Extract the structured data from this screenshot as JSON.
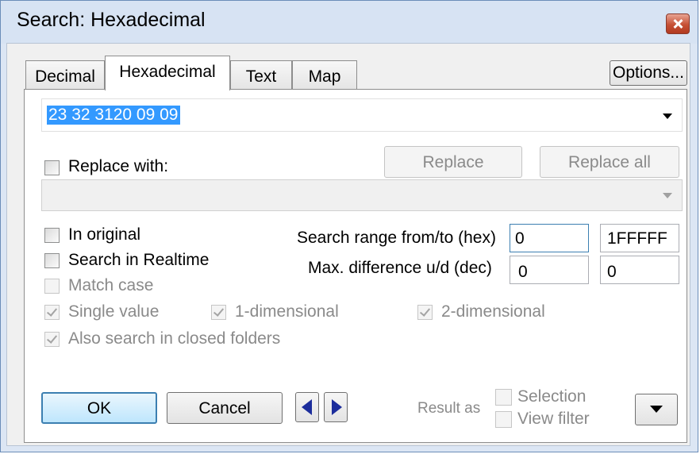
{
  "window": {
    "title": "Search: Hexadecimal"
  },
  "tabs": [
    {
      "label": "Decimal",
      "active": false
    },
    {
      "label": "Hexadecimal",
      "active": true
    },
    {
      "label": "Text",
      "active": false
    },
    {
      "label": "Map",
      "active": false
    }
  ],
  "options_button": "Options...",
  "search": {
    "value": "23 32 3120 09 09"
  },
  "replace": {
    "checkbox_label": "Replace with:",
    "checked": false,
    "value": "",
    "replace_button": "Replace",
    "replace_all_button": "Replace all"
  },
  "options": {
    "in_original": {
      "label": "In original",
      "checked": false
    },
    "search_realtime": {
      "label": "Search in Realtime",
      "checked": false
    },
    "match_case": {
      "label": "Match case",
      "checked": false,
      "enabled": false
    },
    "single_value": {
      "label": "Single value",
      "checked": true,
      "enabled": false
    },
    "one_dim": {
      "label": "1-dimensional",
      "checked": true,
      "enabled": false
    },
    "two_dim": {
      "label": "2-dimensional",
      "checked": true,
      "enabled": false
    },
    "closed_folders": {
      "label": "Also search in closed folders",
      "checked": true,
      "enabled": false
    }
  },
  "range": {
    "label": "Search range from/to (hex)",
    "from": "0",
    "to": "1FFFFF"
  },
  "difference": {
    "label": "Max. difference u/d (dec)",
    "up": "0",
    "down": "0"
  },
  "buttons": {
    "ok": "OK",
    "cancel": "Cancel"
  },
  "result_as": {
    "label": "Result as",
    "selection": "Selection",
    "view_filter": "View filter"
  },
  "colors": {
    "selection_bg": "#3399ff",
    "accent_arrow": "#1c2d9c"
  }
}
